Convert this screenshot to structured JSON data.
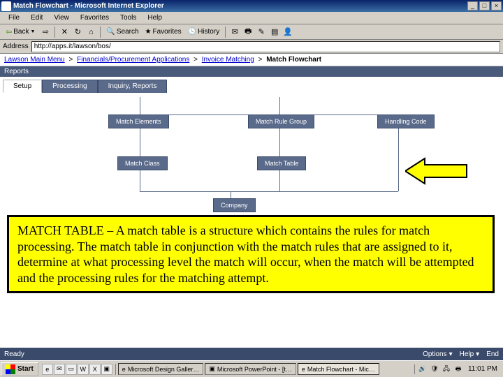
{
  "window": {
    "title": "Match Flowchart - Microsoft Internet Explorer",
    "min": "_",
    "max": "□",
    "close": "×"
  },
  "menu": {
    "file": "File",
    "edit": "Edit",
    "view": "View",
    "favorites": "Favorites",
    "tools": "Tools",
    "help": "Help"
  },
  "toolbar": {
    "back": "Back",
    "search": "Search",
    "favorites": "Favorites",
    "history": "History"
  },
  "address": {
    "label": "Address",
    "url": "http://apps.it/lawson/bos/"
  },
  "breadcrumb": {
    "b1": "Lawson Main Menu",
    "b2": "Financials/Procurement Applications",
    "b3": "Invoice Matching",
    "current": "Match Flowchart",
    "sep": ">"
  },
  "subheader": "Reports",
  "tabs": {
    "setup": "Setup",
    "processing": "Processing",
    "inquiry": "Inquiry, Reports"
  },
  "flowchart": {
    "match_elements": "Match Elements",
    "match_rule_group": "Match Rule Group",
    "handling_code": "Handling Code",
    "match_class": "Match Class",
    "match_table": "Match Table",
    "company": "Company"
  },
  "callout": {
    "text": "MATCH TABLE – A match table is a structure which contains the rules for match processing.  The match table in conjunction with the match rules that are assigned to it, determine at what processing level the match will occur, when the match will be attempted and the processing rules for the matching attempt."
  },
  "statusbar": {
    "left": "Ready",
    "options": "Options",
    "help": "Help",
    "end": "End"
  },
  "taskbar": {
    "start": "Start",
    "task1": "Microsoft Design Galler…",
    "task2": "Microsoft PowerPoint - [t…",
    "task3": "Match Flowchart - Mic…",
    "clock": "11:01 PM"
  }
}
